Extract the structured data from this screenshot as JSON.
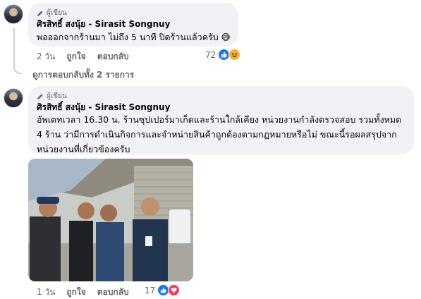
{
  "comment1": {
    "author_badge": "ผู้เขียน",
    "author_name": "ศิรสิทธิ์ สงนุ้ย - Sirasit Songnuy",
    "text": "พอออกจากร้านมา ไม่ถึง 5 นาที ปิดร้านแล้วครับ 😅",
    "time": "2 วัน",
    "like_label": "ถูกใจ",
    "reply_label": "ตอบกลับ",
    "reaction_count": "72",
    "reactions": [
      "like-icon",
      "haha-icon"
    ]
  },
  "replies_toggle": "ดูการตอบกลับทั้ง 2 รายการ",
  "comment2": {
    "author_badge": "ผู้เขียน",
    "author_name": "ศิรสิทธิ์ สงนุ้ย - Sirasit Songnuy",
    "text_lines": [
      "อัพเดทเวลา 16.30 น. ร้านซุปเปอร์มาเก็ตและร้านใกล้เคียง หน่วยงานกำลังตรวจสอบ รวมทั้งหมด",
      "4 ร้าน ว่ามีการดำเนินกิจการและจำหน่ายสินค้าถูกต้องตามกฎหมายหรือไม่ ขณะนี้รอผลสรุปจาก",
      "หน่วยงานที่เกี่ยวข้องครับ"
    ],
    "time": "1 วัน",
    "like_label": "ถูกใจ",
    "reply_label": "ตอบกลับ",
    "reaction_count": "17",
    "reactions": [
      "like-icon",
      "love-icon"
    ]
  },
  "colors": {
    "bubble": "#f0f2f5",
    "secondary_text": "#65676b",
    "like_blue": "#1877f2",
    "love_red": "#f33e58",
    "haha_yellow": "#f7b125"
  }
}
